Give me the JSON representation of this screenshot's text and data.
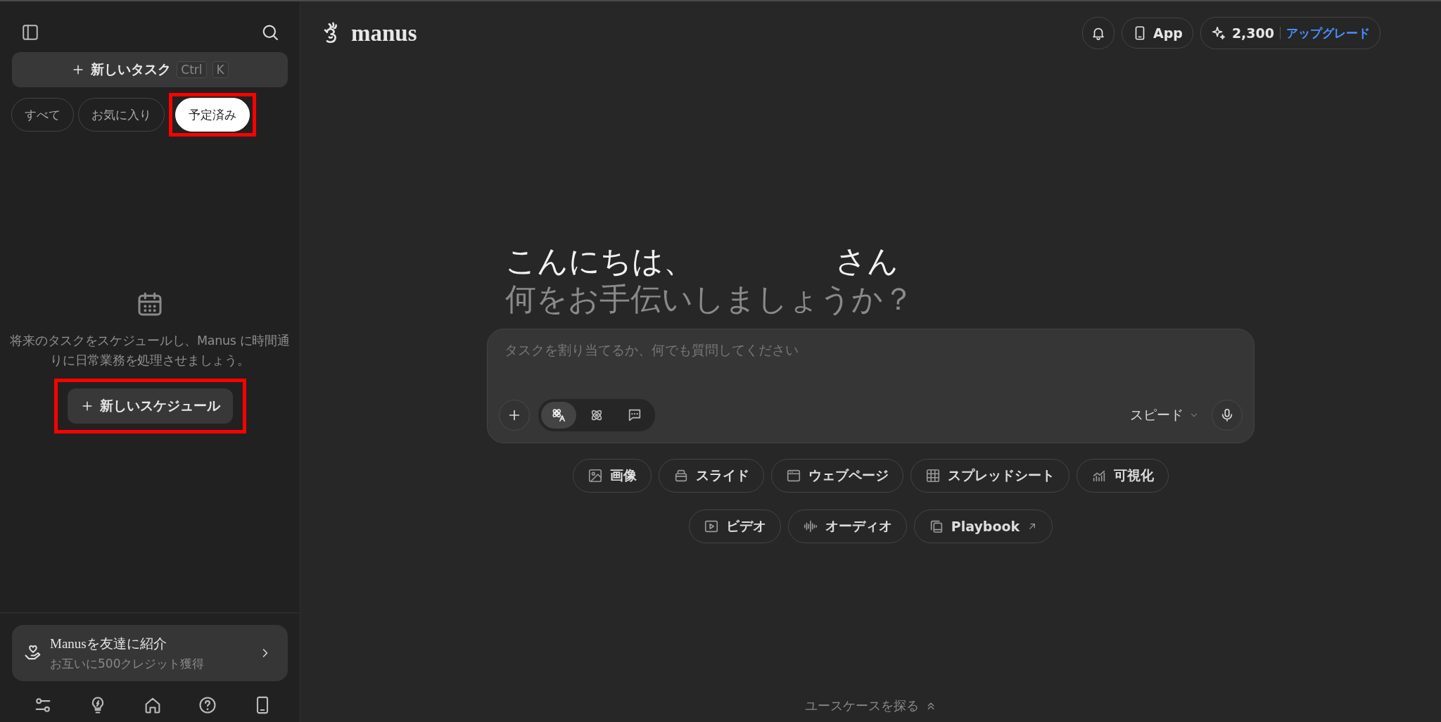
{
  "sidebar": {
    "new_task": {
      "label": "新しいタスク",
      "shortcut": [
        "Ctrl",
        "K"
      ]
    },
    "tabs": [
      {
        "label": "すべて",
        "selected": false,
        "highlighted": false
      },
      {
        "label": "お気に入り",
        "selected": false,
        "highlighted": false
      },
      {
        "label": "予定済み",
        "selected": true,
        "highlighted": true
      }
    ],
    "empty_state": {
      "text": "将来のタスクをスケジュールし、Manus に時間通りに日常業務を処理させましょう。",
      "button": {
        "label": "新しいスケジュール",
        "highlighted": true
      }
    },
    "referral": {
      "title": "Manusを友達に紹介",
      "subtitle": "お互いに500クレジット獲得"
    }
  },
  "header": {
    "logo": "manus",
    "app": "App",
    "credits": "2,300",
    "upgrade": "アップグレード"
  },
  "greeting": {
    "hello": "こんにちは、",
    "suffix": "さん",
    "question": "何をお手伝いしましょうか？"
  },
  "composer": {
    "placeholder": "タスクを割り当てるか、何でも質問してください",
    "modes": [
      {
        "kind": "agent",
        "selected": true
      },
      {
        "kind": "atom",
        "selected": false
      },
      {
        "kind": "chat",
        "selected": false
      }
    ],
    "model": "スピード"
  },
  "chips": [
    {
      "kind": "image",
      "label": "画像"
    },
    {
      "kind": "slides",
      "label": "スライド"
    },
    {
      "kind": "webpage",
      "label": "ウェブページ"
    },
    {
      "kind": "spreadsheet",
      "label": "スプレッドシート"
    },
    {
      "kind": "chart",
      "label": "可視化"
    },
    {
      "kind": "video",
      "label": "ビデオ"
    },
    {
      "kind": "audio",
      "label": "オーディオ"
    },
    {
      "kind": "playbook",
      "label": "Playbook",
      "external": true
    }
  ],
  "explore": "ユースケースを探る"
}
